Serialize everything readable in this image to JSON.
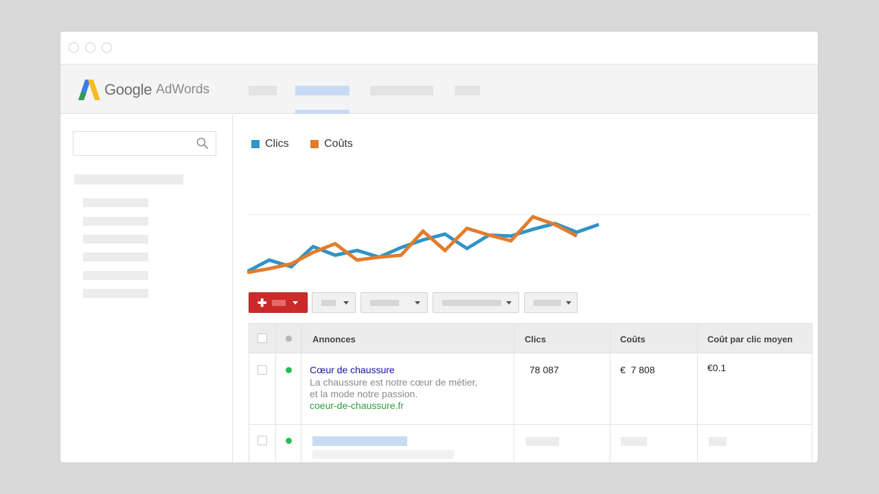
{
  "app": {
    "logo_google": "Google",
    "logo_adwords": "AdWords"
  },
  "colors": {
    "clicks": "#2f94c7",
    "costs": "#e27c2c",
    "add_button": "#cc2a2a",
    "active_dot": "#1fbf5a"
  },
  "chart_data": {
    "type": "line",
    "title": "",
    "xlabel": "",
    "ylabel": "",
    "legend_placement": "top-left",
    "grid": false,
    "x": [
      0,
      1,
      2,
      3,
      4,
      5,
      6,
      7,
      8,
      9,
      10,
      11,
      12,
      13,
      14,
      15,
      16,
      17
    ],
    "ylim": [
      0,
      100
    ],
    "series": [
      {
        "name": "Clics",
        "color": "#2f94c7",
        "values": [
          8,
          20,
          13,
          34,
          25,
          30,
          23,
          33,
          41,
          47,
          32,
          46,
          45,
          52,
          58,
          49,
          57
        ]
      },
      {
        "name": "Coûts",
        "color": "#e27c2c",
        "values": [
          7,
          11,
          16,
          28,
          37,
          20,
          23,
          25,
          50,
          30,
          53,
          46,
          40,
          65,
          57,
          45
        ]
      }
    ]
  },
  "table": {
    "headers": {
      "annonces": "Annonces",
      "clics": "Clics",
      "couts": "Coûts",
      "cpc": "Coût par clic moyen"
    },
    "rows": [
      {
        "title": "Cœur de chaussure",
        "line1": "La chaussure est notre cœur de métier,",
        "line2": "et la mode notre passion.",
        "url": "coeur-de-chaussure.fr",
        "clics": "78 087",
        "couts": "€  7 808",
        "cpc": "€0.1"
      }
    ]
  }
}
